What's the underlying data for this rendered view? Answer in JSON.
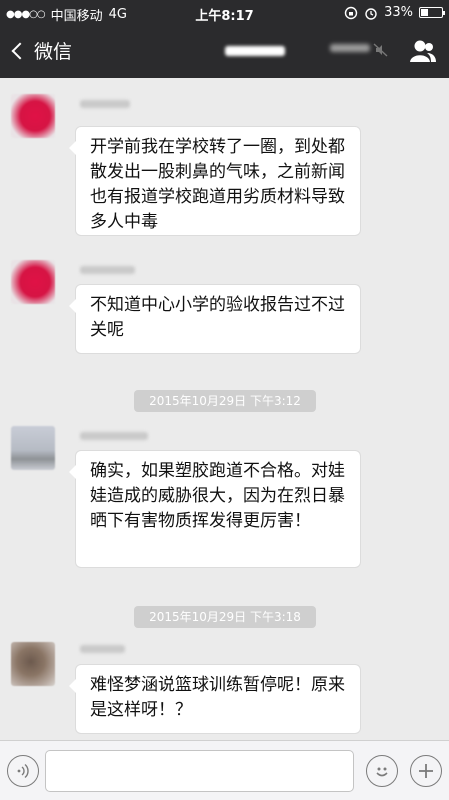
{
  "status_bar": {
    "carrier": "中国移动",
    "network": "4G",
    "time": "上午8:17",
    "battery": "33%"
  },
  "nav": {
    "back_label": "微信"
  },
  "messages": [
    {
      "text": "开学前我在学校转了一圈，到处都散发出一股刺鼻的气味，之前新闻也有报道学校跑道用劣质材料导致多人中毒"
    },
    {
      "text": "不知道中心小学的验收报告过不过关呢"
    },
    {
      "timestamp": "2015年10月29日 下午3:12"
    },
    {
      "text": "确实，如果塑胶跑道不合格。对娃娃造成的威胁很大，因为在烈日暴晒下有害物质挥发得更厉害！"
    },
    {
      "timestamp": "2015年10月29日 下午3:18"
    },
    {
      "text": "难怪梦涵说篮球训练暂停呢！原来是这样呀！？"
    }
  ],
  "input": {
    "placeholder": ""
  }
}
